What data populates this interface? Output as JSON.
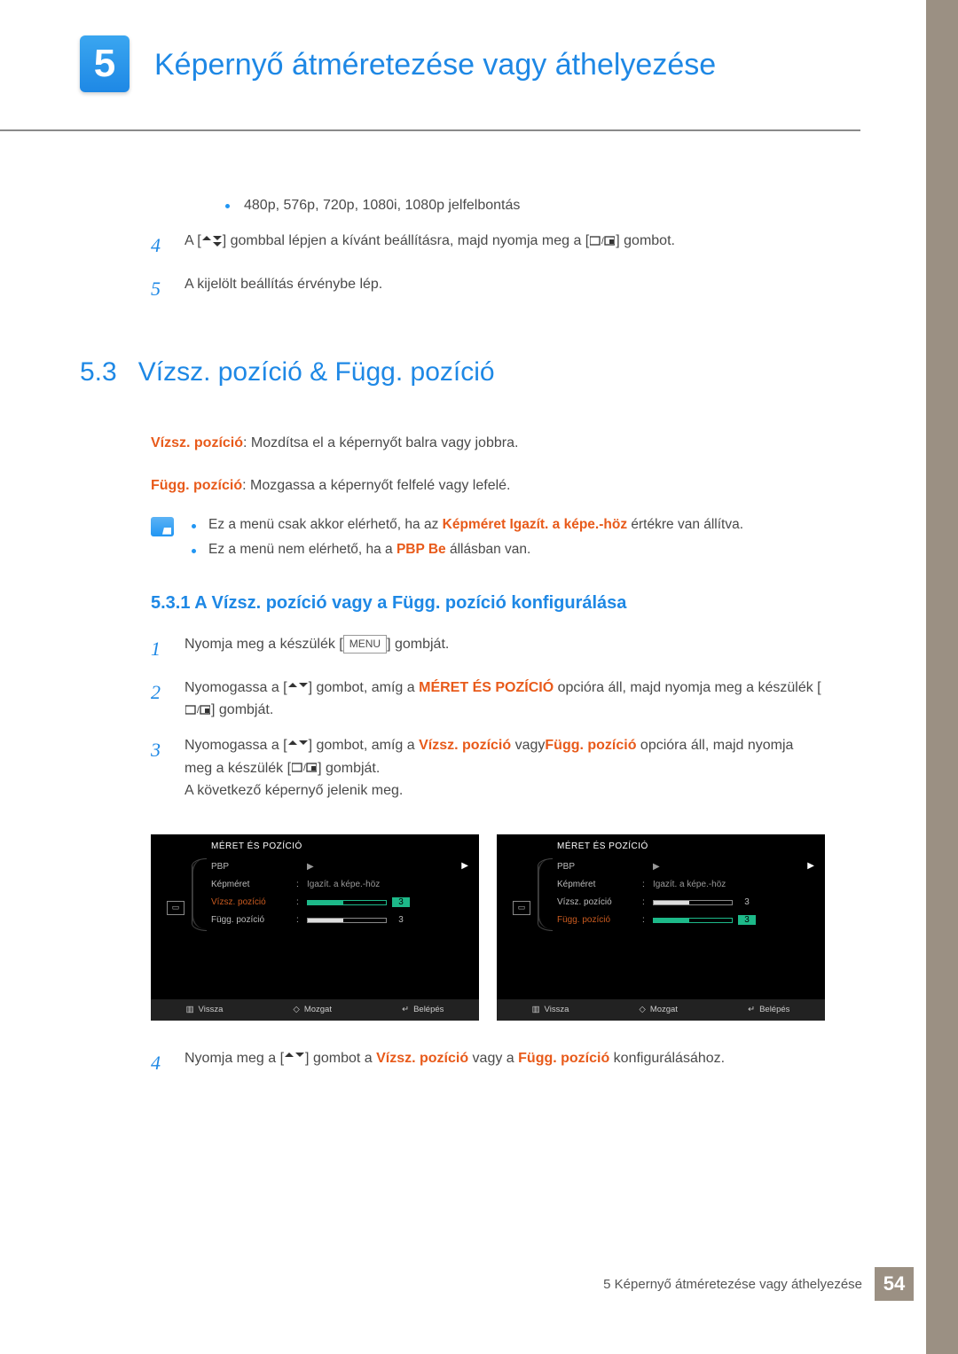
{
  "chapter": {
    "number": "5",
    "title": "Képernyő átméretezése vagy áthelyezése"
  },
  "bullet1": "480p, 576p, 720p, 1080i, 1080p jelfelbontás",
  "topsteps": {
    "s4": {
      "num": "4",
      "text": "A [] gombbal lépjen a kívánt beállításra, majd nyomja meg a [] gombot."
    },
    "s5": {
      "num": "5",
      "text": "A kijelölt beállítás érvénybe lép."
    }
  },
  "section": {
    "num": "5.3",
    "name": "Vízsz. pozíció & Függ. pozíció"
  },
  "def1": {
    "term": "Vízsz. pozíció",
    "desc": ": Mozdítsa el a képernyőt balra vagy jobbra."
  },
  "def2": {
    "term": "Függ. pozíció",
    "desc": ": Mozgassa a képernyőt felfelé vagy lefelé."
  },
  "notes": {
    "n1a": "Ez a menü csak akkor elérhető, ha az ",
    "n1b": "Képméret Igazít. a képe.-höz",
    "n1c": " értékre van állítva.",
    "n2a": "Ez a menü nem elérhető, ha a ",
    "n2b": "PBP Be",
    "n2c": " állásban van."
  },
  "subsection": "5.3.1  A Vízsz. pozíció vagy a Függ. pozíció konfigurálása",
  "steps": {
    "s1": {
      "num": "1",
      "a": "Nyomja meg a készülék [",
      "menu": "MENU",
      "b": "] gombját."
    },
    "s2": {
      "num": "2",
      "a": "Nyomogassa a [] gombot, amíg a ",
      "bold": "MÉRET ÉS POZÍCIÓ",
      "b": " opcióra áll, majd nyomja meg a készülék [] gombját."
    },
    "s3": {
      "num": "3",
      "a": "Nyomogassa a [] gombot, amíg a ",
      "o1": "Vízsz. pozíció",
      "mid": " vagy",
      "o2": "Függ. pozíció",
      "b": " opcióra áll, majd nyomja meg a készülék [] gombját.",
      "c": "A következő képernyő jelenik meg."
    },
    "s4": {
      "num": "4",
      "a": "Nyomja meg a [] gombot a ",
      "o1": "Vízsz. pozíció",
      "mid": " vagy a ",
      "o2": "Függ. pozíció",
      "b": " konfigurálásához."
    }
  },
  "osd": {
    "title": "MÉRET ÉS POZÍCIÓ",
    "rows": {
      "pbp": "PBP",
      "kepm": "Képméret",
      "kepm_val": "Igazít. a képe.-höz",
      "vizsz": "Vízsz. pozíció",
      "fugg": "Függ. pozíció",
      "num3": "3"
    },
    "footer": {
      "back": "Vissza",
      "move": "Mozgat",
      "enter": "Belépés"
    }
  },
  "footer": {
    "text": "5 Képernyő átméretezése vagy áthelyezése",
    "page": "54"
  }
}
